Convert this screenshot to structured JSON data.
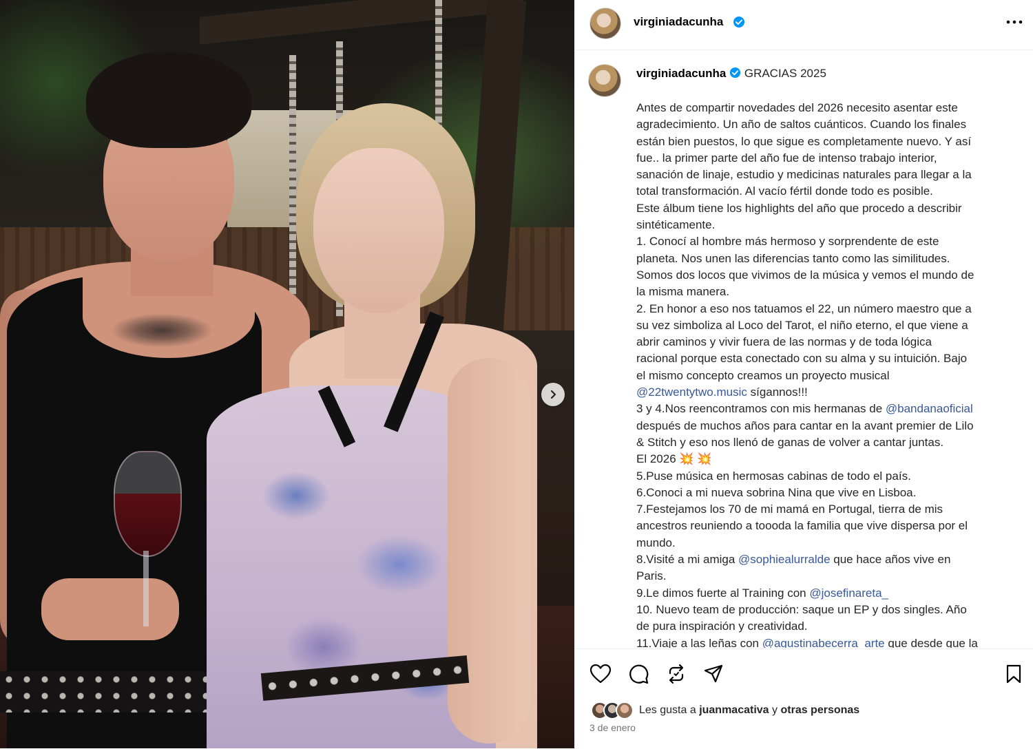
{
  "post": {
    "username": "virginiadacunha",
    "verified": true,
    "title": "GRACIAS 2025",
    "caption_lines": [
      {
        "text": "Antes de compartir novedades del 2026 necesito asentar este"
      },
      {
        "text": "agradecimiento. Un año de saltos cuánticos. Cuando los finales"
      },
      {
        "text": "están bien puestos, lo que sigue es completamente nuevo. Y así"
      },
      {
        "text": "fue.. la primer parte del año fue de intenso trabajo interior,"
      },
      {
        "text": "sanación de linaje, estudio y medicinas naturales para llegar a la"
      },
      {
        "text": "total transformación. Al vacío fértil donde todo es posible."
      },
      {
        "text": "Este álbum tiene los highlights del año que procedo a describir"
      },
      {
        "text": "sintéticamente."
      },
      {
        "text": "1. Conocí al hombre más hermoso y sorprendente de este"
      },
      {
        "text": "planeta. Nos unen las diferencias tanto como las similitudes."
      },
      {
        "text": "Somos dos locos que vivimos de la música y vemos el mundo de"
      },
      {
        "text": "la misma manera."
      },
      {
        "text": "2. En honor a eso nos tatuamos el 22, un número maestro que a"
      },
      {
        "text": "su vez simboliza al Loco del Tarot, el niño eterno, el que viene a"
      },
      {
        "text": "abrir caminos y vivir fuera de las normas y de toda lógica"
      },
      {
        "text": "racional porque esta conectado con su alma y su intuición. Bajo"
      },
      {
        "text": "el mismo concepto creamos un proyecto musical"
      },
      {
        "mention": "@22twentytwo.music",
        "after": " sígannos!!!"
      },
      {
        "before": "3 y 4.Nos reencontramos con mis hermanas de ",
        "mention": "@bandanaoficial"
      },
      {
        "text": "después de muchos años para cantar en la avant premier de Lilo"
      },
      {
        "text": "& Stitch y eso nos llenó de ganas de volver a cantar juntas."
      },
      {
        "text": "El 2026 💥 💥"
      },
      {
        "text": "5.Puse música en hermosas cabinas de todo el país."
      },
      {
        "text": "6.Conoci a mi nueva sobrina Nina que vive en Lisboa."
      },
      {
        "text": "7.Festejamos los 70 de mi mamá en Portugal, tierra de mis"
      },
      {
        "text": "ancestros reuniendo a toooda la familia que vive dispersa por el"
      },
      {
        "text": "mundo."
      },
      {
        "before": "8.Visité a mi amiga ",
        "mention": "@sophiealurralde",
        "after": " que hace años vive en"
      },
      {
        "text": "Paris."
      },
      {
        "before": "9.Le dimos fuerte al Training con ",
        "mention": "@josefinareta_"
      },
      {
        "text": "10. Nuevo team de producción: saque un EP y dos singles. Año"
      },
      {
        "text": "de pura inspiración y creatividad."
      },
      {
        "before": "11.Viaje a las leñas con ",
        "mention": "@agustinabecerra_arte",
        "after": " que desde que la"
      }
    ]
  },
  "likes": {
    "prefix": "Les gusta a",
    "user": "juanmacativa",
    "conj": "y",
    "others": "otras personas"
  },
  "date": "3 de enero",
  "icons": {
    "verified": "verified-badge-icon",
    "more": "more-options-icon",
    "like": "heart-icon",
    "comment": "comment-icon",
    "repost": "repost-icon",
    "share": "send-icon",
    "save": "bookmark-icon",
    "next": "chevron-right-icon"
  },
  "colors": {
    "verified": "#0095f6",
    "mention": "#385898",
    "muted": "#737373"
  }
}
